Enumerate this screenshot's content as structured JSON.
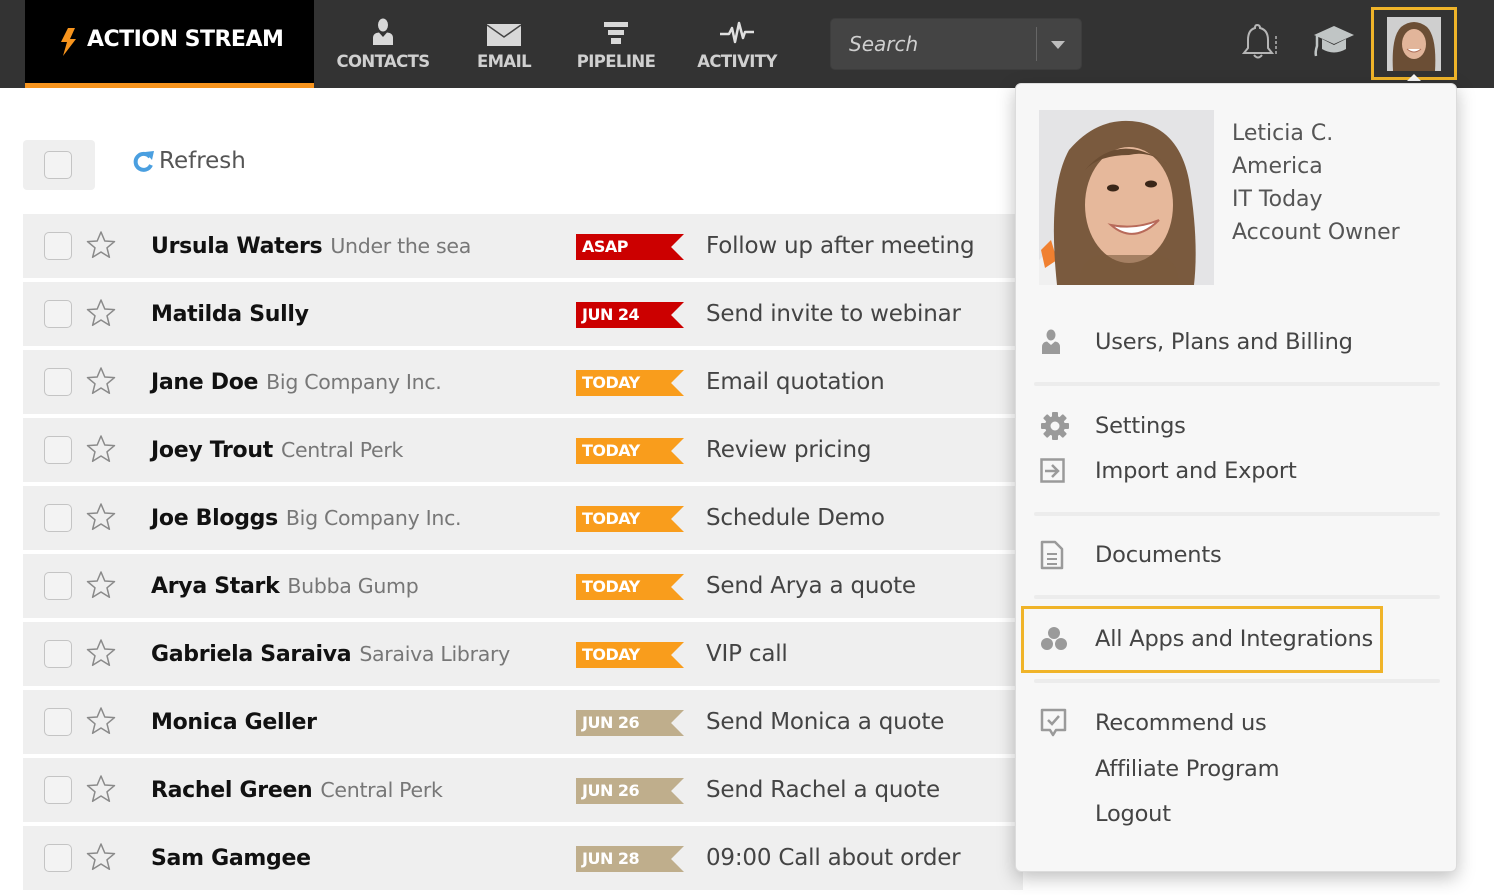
{
  "topbar": {
    "brand": {
      "title": "ACTION STREAM",
      "icon": "lightning-bolt-icon",
      "accent": "#f7941d"
    },
    "nav": [
      {
        "label": "CONTACTS",
        "icon": "person-icon"
      },
      {
        "label": "EMAIL",
        "icon": "envelope-icon"
      },
      {
        "label": "PIPELINE",
        "icon": "funnel-icon"
      },
      {
        "label": "ACTIVITY",
        "icon": "pulse-icon"
      }
    ],
    "search": {
      "placeholder": "Search",
      "value": ""
    },
    "icons": [
      "bell-icon",
      "graduation-cap-icon"
    ],
    "highlight_color": "#f0b429"
  },
  "toolbar": {
    "refresh_label": "Refresh"
  },
  "tag_colors": {
    "red": "#cc0000",
    "orange": "#f99d1c",
    "tan": "#bfae8c"
  },
  "rows": [
    {
      "name": "Ursula Waters",
      "company": "Under the sea",
      "tag": "ASAP",
      "tag_color": "#cc0000",
      "task": "Follow up after meeting"
    },
    {
      "name": "Matilda Sully",
      "company": "",
      "tag": "JUN 24",
      "tag_color": "#cc0000",
      "task": "Send invite to webinar"
    },
    {
      "name": "Jane Doe",
      "company": "Big Company Inc.",
      "tag": "TODAY",
      "tag_color": "#f99d1c",
      "task": "Email quotation"
    },
    {
      "name": "Joey Trout",
      "company": "Central Perk",
      "tag": "TODAY",
      "tag_color": "#f99d1c",
      "task": "Review pricing"
    },
    {
      "name": "Joe Bloggs",
      "company": "Big Company Inc.",
      "tag": "TODAY",
      "tag_color": "#f99d1c",
      "task": "Schedule Demo"
    },
    {
      "name": "Arya Stark",
      "company": "Bubba Gump",
      "tag": "TODAY",
      "tag_color": "#f99d1c",
      "task": "Send Arya a quote"
    },
    {
      "name": "Gabriela Saraiva",
      "company": "Saraiva Library",
      "tag": "TODAY",
      "tag_color": "#f99d1c",
      "task": "VIP call"
    },
    {
      "name": "Monica Geller",
      "company": "",
      "tag": "JUN 26",
      "tag_color": "#bfae8c",
      "task": "Send Monica a quote"
    },
    {
      "name": "Rachel Green",
      "company": "Central Perk",
      "tag": "JUN 26",
      "tag_color": "#bfae8c",
      "task": "Send Rachel a quote"
    },
    {
      "name": "Sam Gamgee",
      "company": "",
      "tag": "JUN 28",
      "tag_color": "#bfae8c",
      "task": "09:00 Call about order"
    }
  ],
  "dropdown": {
    "profile": {
      "name": "Leticia C.",
      "region": "America",
      "company": "IT Today",
      "role": "Account Owner"
    },
    "items": [
      {
        "label": "Users, Plans and Billing",
        "icon": "user-icon"
      },
      {
        "label": "Settings",
        "icon": "gear-icon"
      },
      {
        "label": "Import and Export",
        "icon": "import-icon"
      },
      {
        "label": "Documents",
        "icon": "document-icon"
      },
      {
        "label": "All Apps and Integrations",
        "icon": "apps-icon",
        "highlighted": true
      },
      {
        "label": "Recommend us",
        "icon": "recommend-icon"
      },
      {
        "label": "Affiliate Program",
        "icon": ""
      },
      {
        "label": "Logout",
        "icon": ""
      }
    ]
  }
}
